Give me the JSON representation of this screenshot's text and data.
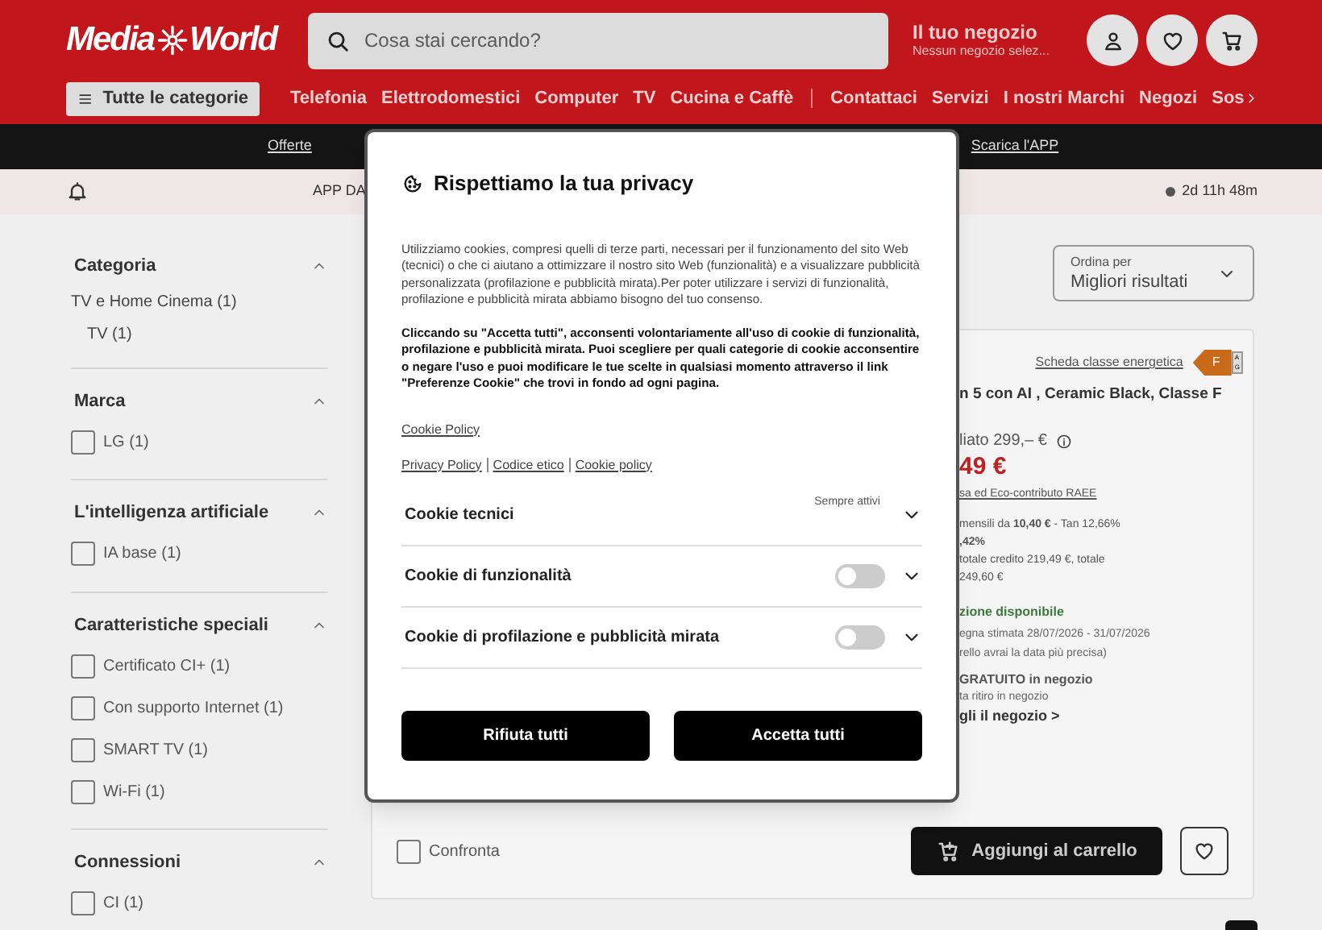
{
  "header": {
    "logo": {
      "left": "Media",
      "right": "World"
    },
    "search": {
      "placeholder": "Cosa stai cercando?"
    },
    "store": {
      "title": "Il tuo negozio",
      "subtitle": "Nessun negozio selez..."
    },
    "categories_button": "Tutte le categorie",
    "nav_primary": [
      "Telefonia",
      "Elettrodomestici",
      "Computer",
      "TV",
      "Cucina e Caffè"
    ],
    "nav_secondary": [
      "Contattaci",
      "Servizi",
      "I nostri Marchi",
      "Negozi",
      "Sos"
    ]
  },
  "top_links": [
    "Offerte",
    "Scarica l'APP"
  ],
  "promo_bar": {
    "text": "APP DA",
    "countdown": "2d 11h 48m"
  },
  "filters": [
    {
      "title": "Categoria",
      "expanded": true,
      "items": [
        {
          "kind": "link",
          "label": "TV e Home Cinema (1)",
          "children": [
            {
              "kind": "link",
              "label": "TV (1)"
            }
          ]
        }
      ]
    },
    {
      "title": "Marca",
      "expanded": true,
      "items": [
        {
          "kind": "checkbox",
          "label": "LG (1)",
          "checked": false
        }
      ]
    },
    {
      "title": "L'intelligenza artificiale",
      "expanded": true,
      "items": [
        {
          "kind": "checkbox",
          "label": "IA base (1)",
          "checked": false
        }
      ]
    },
    {
      "title": "Caratteristiche speciali",
      "expanded": true,
      "items": [
        {
          "kind": "checkbox",
          "label": "Certificato CI+ (1)",
          "checked": false
        },
        {
          "kind": "checkbox",
          "label": "Con supporto Internet (1)",
          "checked": false
        },
        {
          "kind": "checkbox",
          "label": "SMART TV (1)",
          "checked": false
        },
        {
          "kind": "checkbox",
          "label": "Wi-Fi (1)",
          "checked": false
        }
      ]
    },
    {
      "title": "Connessioni",
      "expanded": true,
      "items": [
        {
          "kind": "checkbox",
          "label": "CI (1)",
          "checked": false
        }
      ]
    }
  ],
  "sort": {
    "label": "Ordina per",
    "value": "Migliori risultati"
  },
  "product": {
    "energy_link": "Scheda classe energetica",
    "energy_class": "F",
    "energy_scale": [
      "A",
      "G"
    ],
    "title": "n 5 con AI , Ceramic Black, Classe F",
    "list_price": "liato 299,– €",
    "price": "49 €",
    "eco_note": "sa ed Eco-contributo RAEE",
    "financing": [
      "mensili da **10,40 €** - Tan 12,66%",
      "**,42%**",
      "totale credito 219,49 €, totale",
      "249,60 €"
    ],
    "availability": "zione disponibile",
    "delivery": [
      "egna stimata 28/07/2026 - 31/07/2026",
      "rello avrai la data più precisa)"
    ],
    "pickup_title": "GRATUITO in negozio",
    "pickup_note": "ta ritiro in negozio",
    "store_link": "gli il negozio >",
    "compare": {
      "label": "Confronta",
      "checked": false
    },
    "add_to_cart": "Aggiungi al carrello"
  },
  "cookie_dialog": {
    "title": "Rispettiamo la tua privacy",
    "intro": "Utilizziamo cookies, compresi quelli di terze parti, necessari per il funzionamento del sito Web (tecnici) o che ci aiutano a ottimizzare il nostro sito Web (funzionalità) e a visualizzare pubblicità personalizzata (profilazione e pubblicità mirata).Per poter utilizzare i servizi di funzionalità, profilazione e pubblicità mirata abbiamo bisogno del tuo consenso.",
    "consent": "Cliccando su \"Accetta tutti\", acconsenti volontariamente all'uso di cookie di funzionalità, profilazione e pubblicità mirata. Puoi scegliere per quali categorie di cookie acconsentire o negare l'uso e puoi modificare le tue scelte in qualsiasi momento attraverso il link \"Preferenze Cookie\" che trovi in fondo ad ogni pagina.",
    "policy_link": "Cookie Policy",
    "links": [
      "Privacy Policy",
      "Codice etico",
      "Cookie policy"
    ],
    "categories": [
      {
        "kind": "always",
        "name": "Cookie tecnici",
        "note": "Sempre attivi",
        "expanded": false
      },
      {
        "kind": "toggle",
        "name": "Cookie di funzionalità",
        "on": false,
        "expanded": false
      },
      {
        "kind": "toggle",
        "name": "Cookie di profilazione e pubblicità mirata",
        "on": false,
        "expanded": false
      }
    ],
    "buttons": [
      "Rifiuta tutti",
      "Accetta tutti"
    ]
  }
}
